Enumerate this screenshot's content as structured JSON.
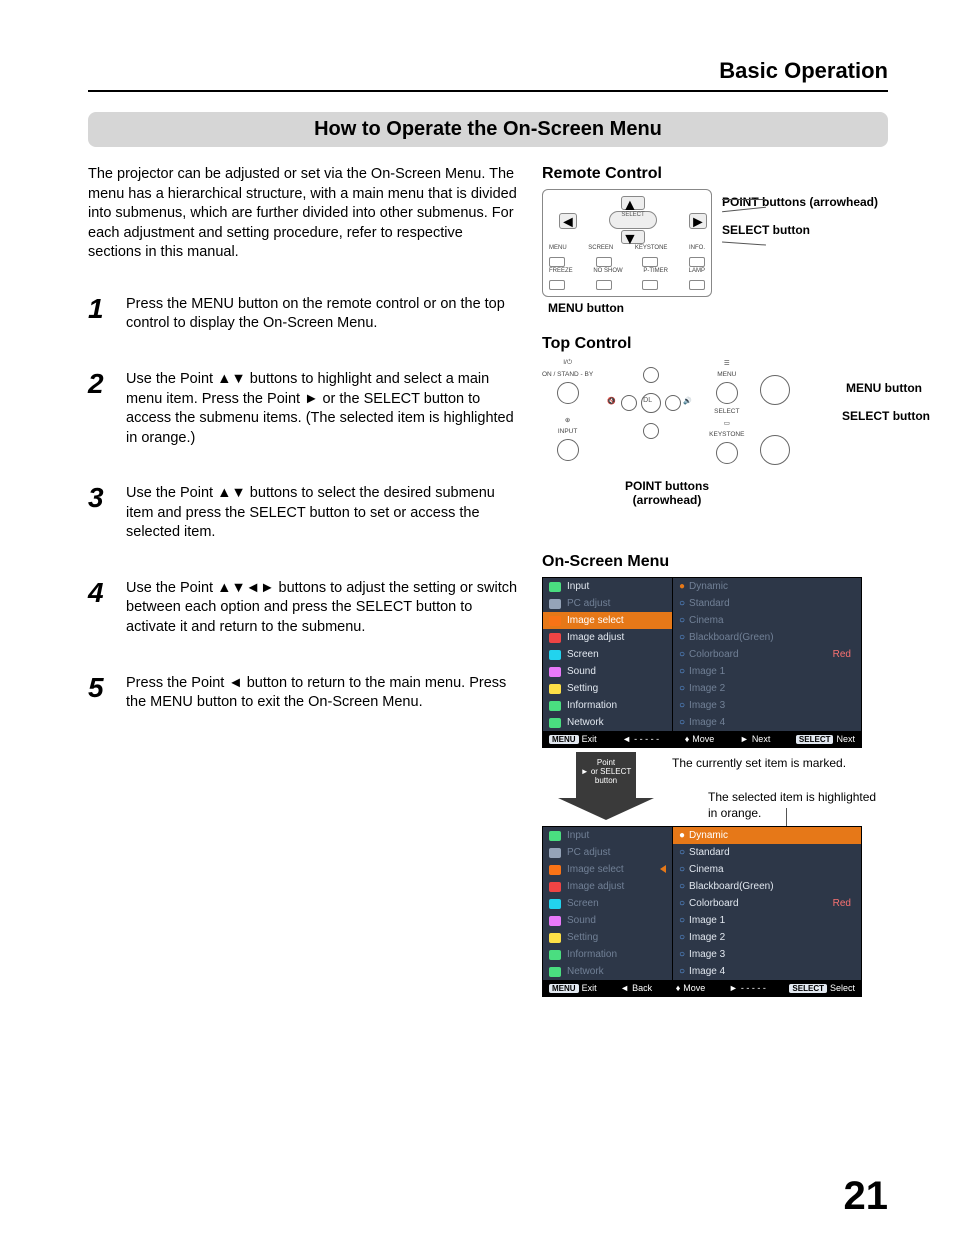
{
  "header": {
    "section": "Basic Operation"
  },
  "title": "How to Operate the On-Screen Menu",
  "intro": "The projector can be adjusted or set via the On-Screen Menu. The menu has a hierarchical structure, with a main menu that is divided into submenus, which are further divided into other submenus. For each adjustment and setting procedure, refer to respective sections in this manual.",
  "steps": [
    {
      "n": "1",
      "t": "Press the MENU button on the remote control or on the top control to display the On-Screen Menu."
    },
    {
      "n": "2",
      "t": "Use the Point ▲▼ buttons to highlight and select a main menu item. Press the Point ► or the SELECT button to access the submenu items. (The selected item is highlighted in orange.)"
    },
    {
      "n": "3",
      "t": "Use the Point ▲▼ buttons to select the desired submenu item and press the SELECT button to set or access the selected item."
    },
    {
      "n": "4",
      "t": "Use the Point ▲▼◄► buttons to adjust the setting or switch between each option and press the SELECT button to activate it and return to the submenu."
    },
    {
      "n": "5",
      "t": "Press the Point ◄ button to return to the main menu. Press the MENU button to exit the On-Screen Menu."
    }
  ],
  "remote": {
    "heading": "Remote Control",
    "point": "POINT buttons (arrowhead)",
    "select": "SELECT button",
    "menu": "MENU button",
    "row1": [
      "MENU",
      "SCREEN",
      "KEYSTONE",
      "INFO."
    ],
    "row2": [
      "FREEZE",
      "NO SHOW",
      "P-TIMER",
      "LAMP"
    ],
    "sel_label": "SELECT"
  },
  "top": {
    "heading": "Top Control",
    "menu": "MENU button",
    "select": "SELECT button",
    "point": "POINT buttons (arrowhead)",
    "standby": "ON / STAND - BY",
    "input": "INPUT",
    "menu_lbl": "MENU",
    "select_lbl": "SELECT",
    "keystone": "KEYSTONE",
    "vol": "DL",
    "power_sym": "I/⏻"
  },
  "osm": {
    "heading": "On-Screen Menu",
    "main": [
      "Input",
      "PC adjust",
      "Image select",
      "Image adjust",
      "Screen",
      "Sound",
      "Setting",
      "Information",
      "Network"
    ],
    "sub": [
      "Dynamic",
      "Standard",
      "Cinema",
      "Blackboard(Green)",
      "Colorboard",
      "Image 1",
      "Image 2",
      "Image 3",
      "Image 4"
    ],
    "red": "Red",
    "footer1": {
      "exit": "Exit",
      "a": "- - - - -",
      "b": "Move",
      "c": "Next",
      "d": "Next",
      "menu": "MENU",
      "sel": "SELECT"
    },
    "footer2": {
      "exit": "Exit",
      "a": "Back",
      "b": "Move",
      "c": "- - - - -",
      "d": "Select",
      "menu": "MENU",
      "sel": "SELECT"
    },
    "arrow_label": "Point\n► or SELECT\nbutton",
    "note1": "The currently set item is marked.",
    "note2": "The selected item is highlighted in orange."
  },
  "page": "21"
}
